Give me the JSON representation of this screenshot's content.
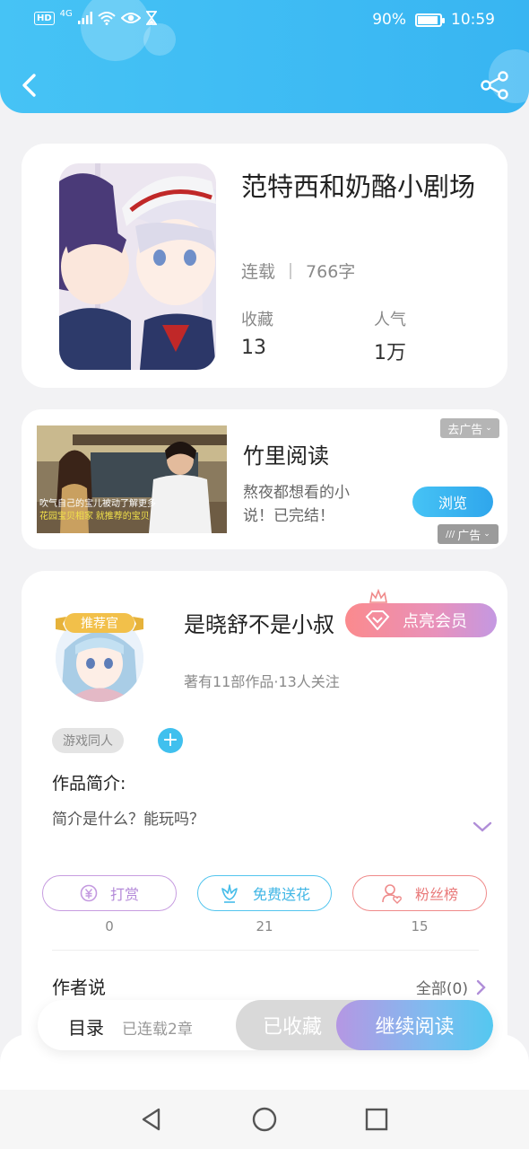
{
  "status_bar": {
    "hd": "HD",
    "network": "4G",
    "battery_percent": "90%",
    "battery_level": 0.9,
    "time": "10:59"
  },
  "header": {
    "back_icon": "chevron-left-icon",
    "share_icon": "share-icon",
    "background_color": "#3fbdf4"
  },
  "book": {
    "title": "范特西和奶酪小剧场",
    "status": "连载",
    "word_count": "766字",
    "favorites_label": "收藏",
    "favorites_value": "13",
    "popularity_label": "人气",
    "popularity_value": "1万"
  },
  "ad": {
    "title": "竹里阅读",
    "description": "熬夜都想看的小说！已完结！",
    "close_label": "去广告",
    "browse_label": "浏览",
    "ad_label": "广告"
  },
  "author": {
    "badge": "推荐官",
    "name": "是晓舒不是小叔",
    "stats": "著有11部作品·13人关注",
    "vip_label": "点亮会员",
    "tag": "游戏同人",
    "add_tag_symbol": "+",
    "intro_title": "作品简介:",
    "intro_text": "简介是什么？能玩吗？"
  },
  "actions": [
    {
      "label": "打赏",
      "count": "0",
      "icon": "coin-icon",
      "color": "#b48ad9"
    },
    {
      "label": "免费送花",
      "count": "21",
      "icon": "flower-icon",
      "color": "#40b6e5"
    },
    {
      "label": "粉丝榜",
      "count": "15",
      "icon": "fans-icon",
      "color": "#e97a7a"
    }
  ],
  "author_says": {
    "title": "作者说",
    "view_all": "全部(0)"
  },
  "bottom_bar": {
    "toc": "目录",
    "chapters": "已连载2章",
    "collected": "已收藏",
    "continue": "继续阅读"
  },
  "ad_image": {
    "caption_line1": "吹气自己的宝儿被动了解更多",
    "caption_line2": "花园宝贝相家 就推荐的宝贝"
  }
}
